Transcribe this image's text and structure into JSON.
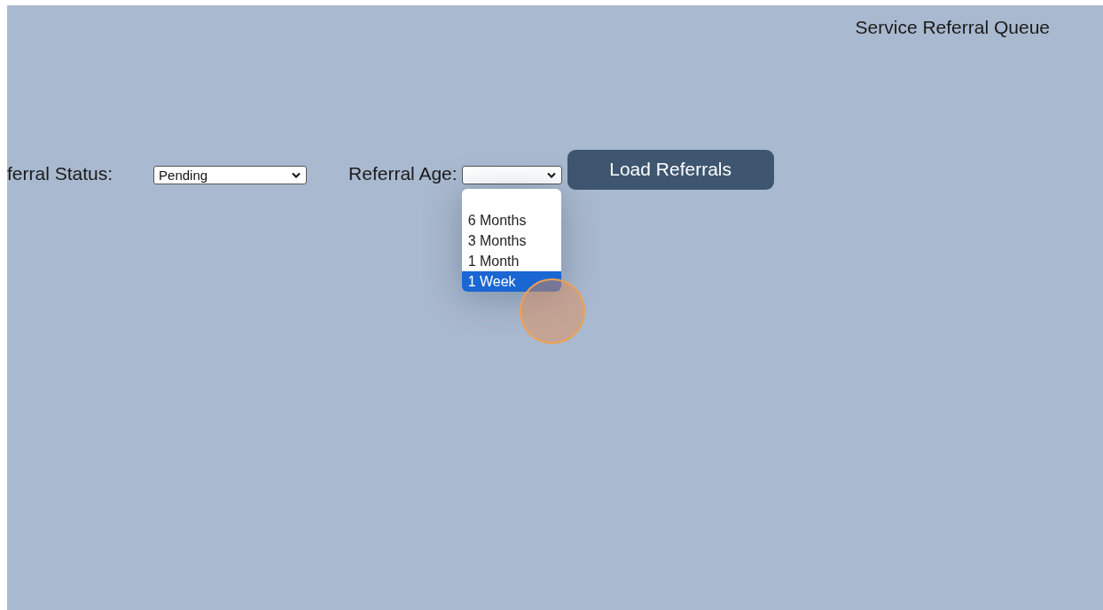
{
  "page": {
    "title": "Service Referral Queue"
  },
  "filters": [
    {
      "label": "ferral Status:",
      "value": "Pending"
    },
    {
      "label": "Referral Age:",
      "options": [
        {
          "label": "6 Months",
          "selected": false
        },
        {
          "label": "3 Months",
          "selected": false
        },
        {
          "label": "1 Month",
          "selected": false
        },
        {
          "label": "1 Week",
          "selected": true
        }
      ]
    }
  ],
  "button": {
    "label": "Load Referrals"
  }
}
